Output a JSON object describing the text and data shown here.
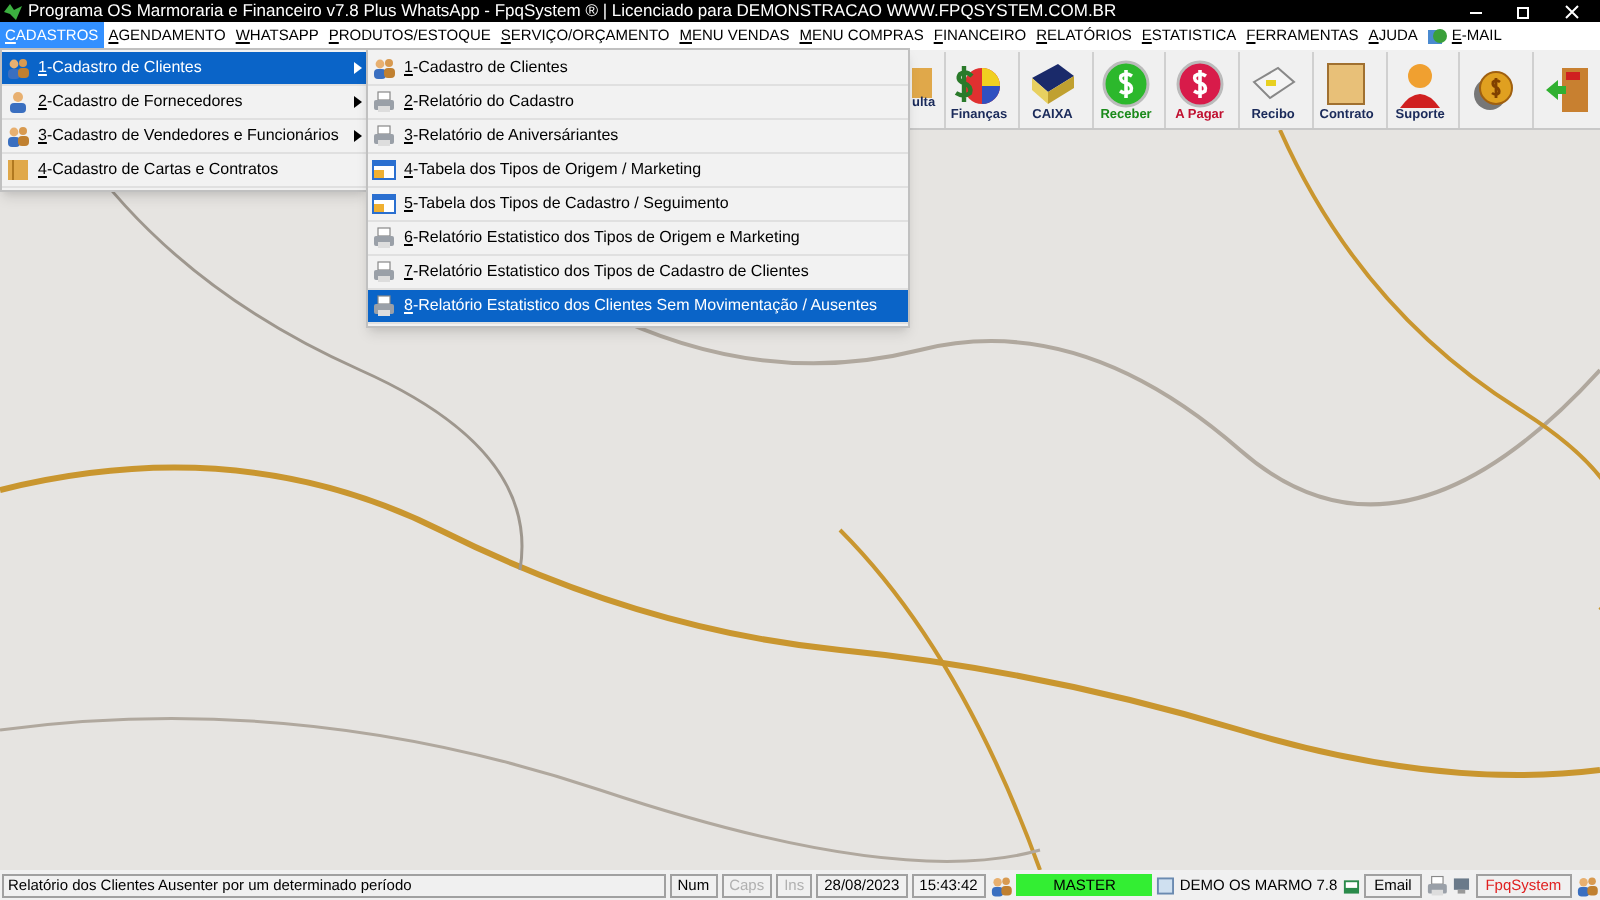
{
  "window": {
    "title": "Programa OS Marmoraria e Financeiro v7.8 Plus WhatsApp - FpqSystem ® | Licenciado para  DEMONSTRACAO WWW.FPQSYSTEM.COM.BR"
  },
  "menu_bar": [
    {
      "label": "CADASTROS",
      "selected": true,
      "kind": "text"
    },
    {
      "label": "AGENDAMENTO",
      "selected": false,
      "kind": "text"
    },
    {
      "label": "WHATSAPP",
      "selected": false,
      "kind": "text"
    },
    {
      "label": "PRODUTOS/ESTOQUE",
      "selected": false,
      "kind": "text"
    },
    {
      "label": "SERVIÇO/ORÇAMENTO",
      "selected": false,
      "kind": "text"
    },
    {
      "label": "MENU VENDAS",
      "selected": false,
      "kind": "text"
    },
    {
      "label": "MENU COMPRAS",
      "selected": false,
      "kind": "text"
    },
    {
      "label": "FINANCEIRO",
      "selected": false,
      "kind": "text"
    },
    {
      "label": "RELATÓRIOS",
      "selected": false,
      "kind": "text"
    },
    {
      "label": "ESTATISTICA",
      "selected": false,
      "kind": "text"
    },
    {
      "label": "FERRAMENTAS",
      "selected": false,
      "kind": "text"
    },
    {
      "label": "AJUDA",
      "selected": false,
      "kind": "text"
    },
    {
      "label": "E-MAIL",
      "selected": false,
      "kind": "email"
    }
  ],
  "toolbar": [
    {
      "label": "ulta",
      "kind": "folder"
    },
    {
      "label": "Finanças",
      "kind": "finance"
    },
    {
      "label": "CAIXA",
      "kind": "book"
    },
    {
      "label": "Receber",
      "kind": "receive"
    },
    {
      "label": "A Pagar",
      "kind": "pay"
    },
    {
      "label": "Recibo",
      "kind": "receipt"
    },
    {
      "label": "Contrato",
      "kind": "scroll"
    },
    {
      "label": "Suporte",
      "kind": "support"
    },
    {
      "kind": "coin"
    },
    {
      "kind": "exit"
    }
  ],
  "menu": [
    {
      "label": "1-Cadastro de Clientes",
      "selected": true,
      "submenu": true,
      "kind": "people"
    },
    {
      "label": "2-Cadastro de Fornecedores",
      "selected": false,
      "submenu": true,
      "kind": "person"
    },
    {
      "label": "3-Cadastro de Vendedores e Funcionários",
      "selected": false,
      "submenu": true,
      "kind": "people"
    },
    {
      "label": "4-Cadastro de Cartas e Contratos",
      "selected": false,
      "submenu": false,
      "kind": "folder"
    }
  ],
  "submenu": [
    {
      "label": "1-Cadastro de Clientes",
      "selected": false,
      "kind": "people"
    },
    {
      "label": "2-Relatório do Cadastro",
      "selected": false,
      "kind": "printer"
    },
    {
      "label": "3-Relatório de Aniversáriantes",
      "selected": false,
      "kind": "printer"
    },
    {
      "label": "4-Tabela dos Tipos de Origem / Marketing",
      "selected": false,
      "kind": "table"
    },
    {
      "label": "5-Tabela dos Tipos de Cadastro / Seguimento",
      "selected": false,
      "kind": "table"
    },
    {
      "label": "6-Relatório Estatistico dos Tipos de Origem e Marketing",
      "selected": false,
      "kind": "printer"
    },
    {
      "label": "7-Relatório Estatistico dos Tipos de Cadastro de Clientes",
      "selected": false,
      "kind": "printer"
    },
    {
      "label": "8-Relatório Estatistico dos Clientes Sem Movimentação / Ausentes",
      "selected": true,
      "kind": "printer"
    }
  ],
  "status_bar": {
    "message": "Relatório dos Clientes Ausenter por um determinado período",
    "indicators": [
      {
        "label": "Num",
        "disabled": false
      },
      {
        "label": "Caps",
        "disabled": true
      },
      {
        "label": "Ins",
        "disabled": true
      }
    ],
    "date": "28/08/2023",
    "time": "15:43:42",
    "user": "MASTER",
    "version": "DEMO OS MARMO 7.8",
    "email": "Email",
    "brand": "FpqSystem"
  }
}
